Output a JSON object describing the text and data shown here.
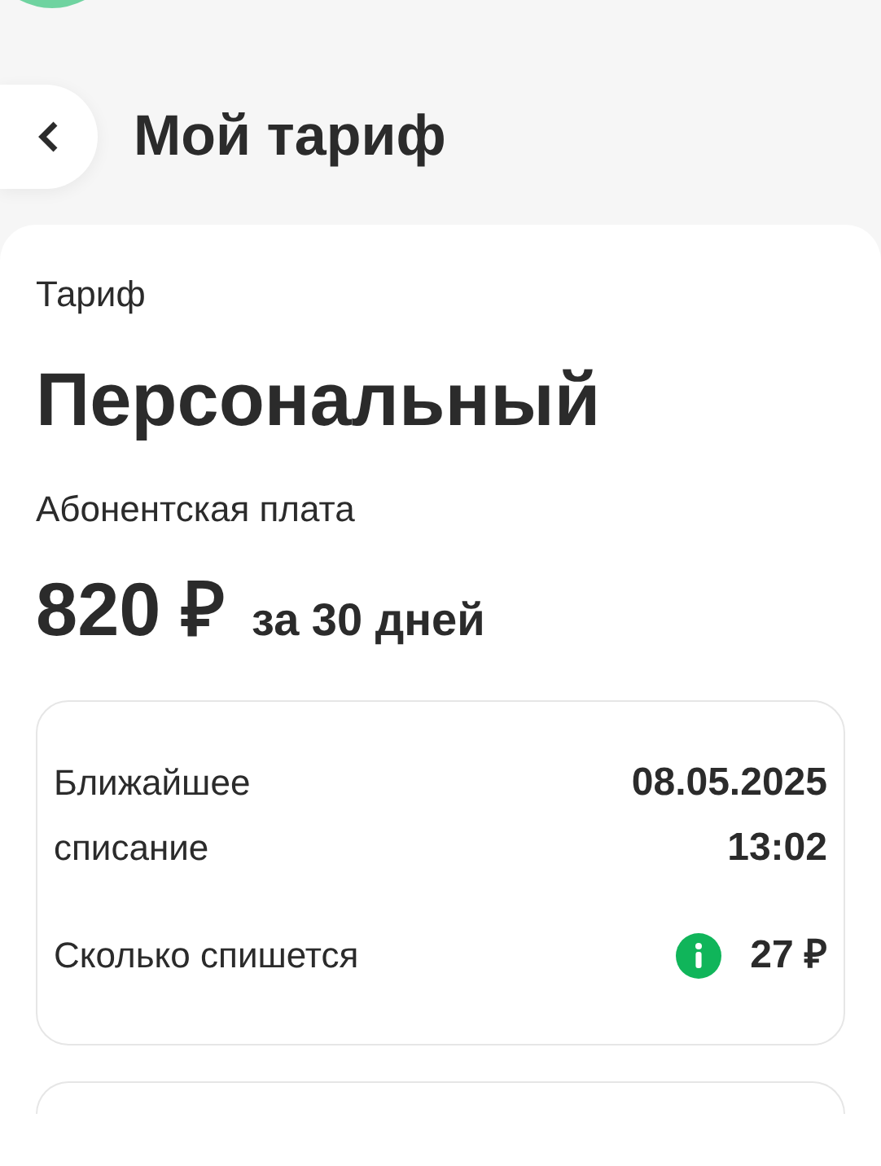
{
  "header": {
    "title": "Мой тариф"
  },
  "tariff": {
    "label": "Тариф",
    "name": "Персональный",
    "fee_label": "Абонентская плата",
    "price": "820 ₽",
    "period": "за 30 дней"
  },
  "charge": {
    "rows": [
      {
        "label": "Ближайшее",
        "value": "08.05.2025",
        "info": false
      },
      {
        "label": "списание",
        "value": "13:02",
        "info": false
      },
      {
        "label": "Сколько спишется",
        "value": "27 ₽",
        "info": true
      }
    ]
  }
}
